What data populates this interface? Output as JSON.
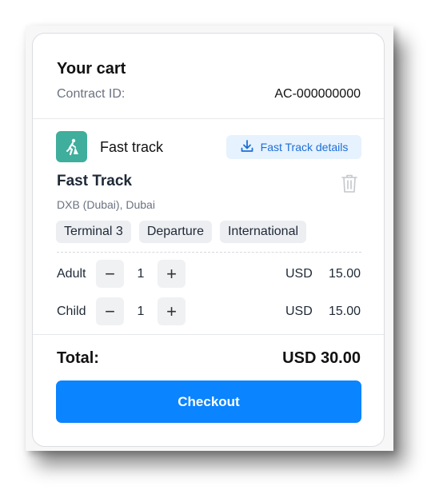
{
  "cart": {
    "title": "Your cart",
    "contract_label": "Contract ID:",
    "contract_id": "AC-000000000"
  },
  "product": {
    "icon": "walking-person-icon",
    "name": "Fast track",
    "details_button": "Fast Track details",
    "item_title": "Fast Track",
    "location": "DXB (Dubai), Dubai",
    "tags": [
      "Terminal 3",
      "Departure",
      "International"
    ]
  },
  "passengers": [
    {
      "label": "Adult",
      "qty": "1",
      "currency": "USD",
      "price": "15.00"
    },
    {
      "label": "Child",
      "qty": "1",
      "currency": "USD",
      "price": "15.00"
    }
  ],
  "stepper": {
    "minus": "−",
    "plus": "+"
  },
  "total": {
    "label": "Total:",
    "value": "USD 30.00"
  },
  "checkout_label": "Checkout",
  "colors": {
    "accent": "#0a84ff",
    "product_icon_bg": "#3fae9c",
    "details_bg": "#e6f2fe",
    "details_text": "#1d6fd6"
  }
}
